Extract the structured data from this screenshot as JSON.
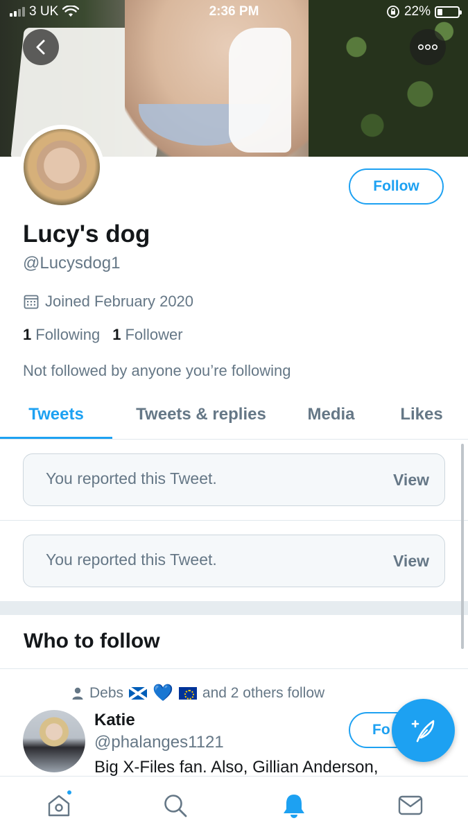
{
  "status_bar": {
    "carrier": "3 UK",
    "time": "2:36 PM",
    "battery": "22%",
    "battery_level": 0.22
  },
  "header": {
    "back_icon": "chevron-left-icon",
    "more_icon": "more-horizontal-icon"
  },
  "profile": {
    "display_name": "Lucy's dog",
    "handle": "@Lucysdog1",
    "joined": "Joined February 2020",
    "following_count": "1",
    "following_label": "Following",
    "followers_count": "1",
    "followers_label": "Follower",
    "not_followed_text": "Not followed by anyone you’re following",
    "follow_label": "Follow"
  },
  "tabs": [
    {
      "label": "Tweets",
      "active": true
    },
    {
      "label": "Tweets & replies",
      "active": false
    },
    {
      "label": "Media",
      "active": false
    },
    {
      "label": "Likes",
      "active": false
    }
  ],
  "reported_tweets": [
    {
      "text": "You reported this Tweet.",
      "action": "View"
    },
    {
      "text": "You reported this Tweet.",
      "action": "View"
    }
  ],
  "who_to_follow": {
    "title": "Who to follow",
    "social_context_name": "Debs",
    "social_context_rest": "and 2 others follow",
    "suggestion": {
      "name": "Katie",
      "handle": "@phalanges1121",
      "bio": "Big X-Files fan. Also, Gillian Anderson,",
      "follow_label": "Fo"
    }
  },
  "bottom_nav": [
    {
      "icon": "home-icon"
    },
    {
      "icon": "search-icon"
    },
    {
      "icon": "notifications-icon"
    },
    {
      "icon": "messages-icon"
    }
  ],
  "colors": {
    "accent": "#1da1f2",
    "secondary_text": "#657786",
    "primary_text": "#14171a"
  }
}
